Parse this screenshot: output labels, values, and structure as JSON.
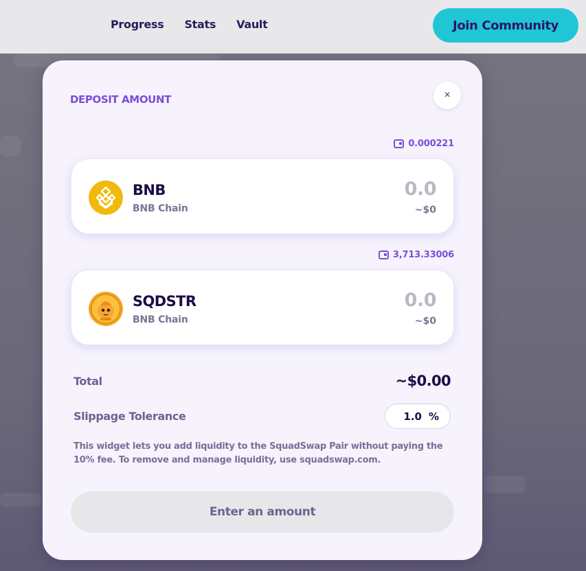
{
  "nav": {
    "items": [
      "Progress",
      "Stats",
      "Vault"
    ],
    "join_label": "Join Community"
  },
  "modal": {
    "title": "DEPOSIT AMOUNT",
    "close_glyph": "×",
    "tokens": [
      {
        "balance": "0.000221",
        "symbol": "BNB",
        "chain": "BNB Chain",
        "amount": "0.0",
        "usd": "~$0",
        "icon": "bnb-icon"
      },
      {
        "balance": "3,713.33006",
        "symbol": "SQDSTR",
        "chain": "BNB Chain",
        "amount": "0.0",
        "usd": "~$0",
        "icon": "sqdstr-icon"
      }
    ],
    "total_label": "Total",
    "total_value": "~$0.00",
    "slippage_label": "Slippage Tolerance",
    "slippage_value": "1.0",
    "slippage_unit": "%",
    "info_text": "This widget lets you add liquidity to the SquadSwap Pair without paying the 10% fee. To remove and manage liquidity, use squadswap.com.",
    "submit_label": "Enter an amount"
  },
  "colors": {
    "accent": "#7a4fd6",
    "join_button": "#21c6d6",
    "bnb_yellow": "#f0b90b"
  }
}
